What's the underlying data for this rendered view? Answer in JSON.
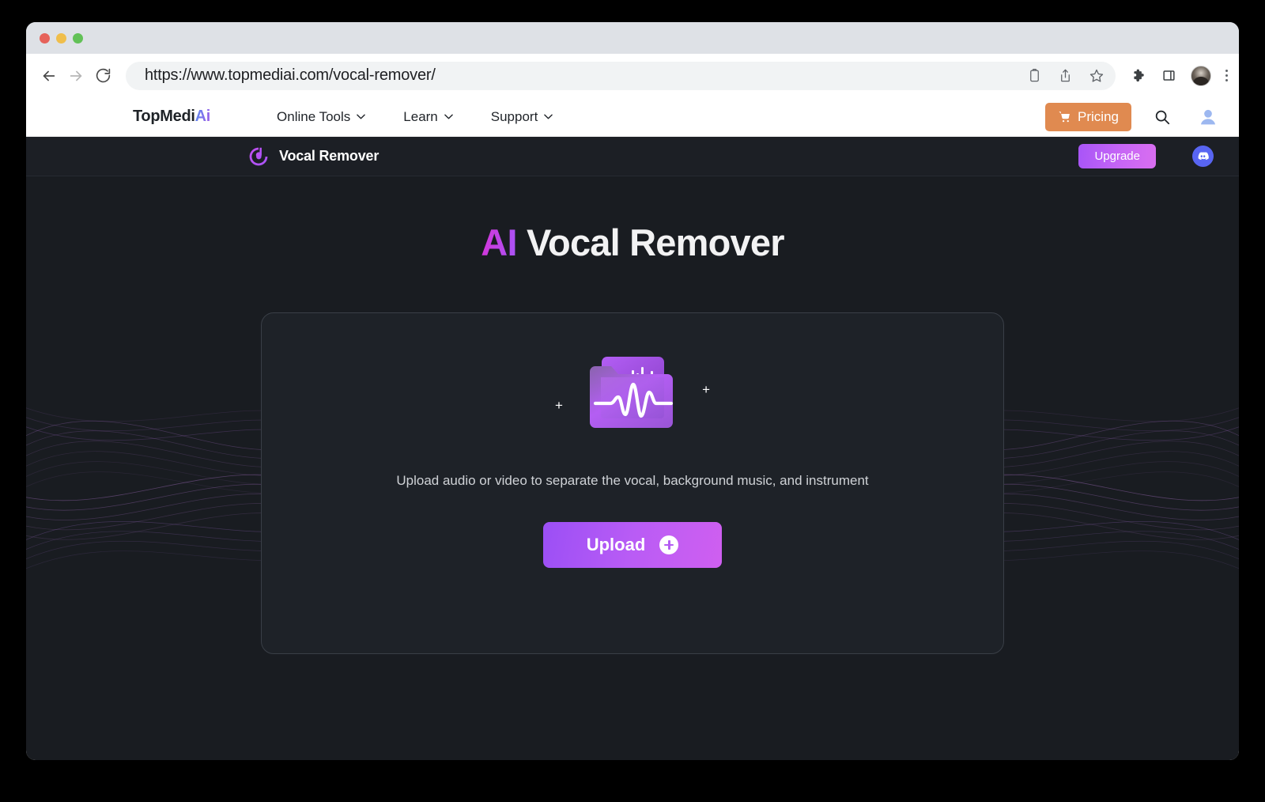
{
  "browser": {
    "url": "https://www.topmediai.com/vocal-remover/",
    "traffic_lights": [
      "close",
      "minimize",
      "maximize"
    ],
    "toolbar_icons": [
      "back-arrow",
      "forward-arrow",
      "reload",
      "clipboard-icon",
      "share-icon",
      "bookmark-star-icon",
      "extensions-puzzle-icon",
      "side-panel-icon",
      "profile-avatar",
      "menu-kebab-icon"
    ]
  },
  "site_nav": {
    "brand_main": "TopMedi",
    "brand_accent": "Ai",
    "links": [
      {
        "label": "Online Tools",
        "icon": "chevron-down-icon"
      },
      {
        "label": "Learn",
        "icon": "chevron-down-icon"
      },
      {
        "label": "Support",
        "icon": "chevron-down-icon"
      }
    ],
    "pricing_label": "Pricing",
    "pricing_icon": "shopping-cart-icon",
    "pricing_color": "#e08a50",
    "search_icon": "search-icon",
    "account_icon": "user-avatar-icon"
  },
  "app_header": {
    "logo_icon": "music-note-logo",
    "title": "Vocal Remover",
    "upgrade_label": "Upgrade",
    "upgrade_color": "#c766f5",
    "discord_icon": "discord-icon",
    "discord_color": "#5865f2"
  },
  "hero": {
    "title_accent": "AI",
    "title_main": "Vocal Remover",
    "accent_color": "#c434d8"
  },
  "dropzone": {
    "icon": "audio-folder-waveform-icon",
    "plus_left": "+",
    "plus_right": "+",
    "description": "Upload audio or video to separate the vocal, background music, and instrument",
    "upload_label": "Upload",
    "upload_icon": "plus-circle-icon",
    "upload_color": "#b95cf5"
  },
  "background": {
    "page_color": "#191c21",
    "card_color": "#1e2228",
    "decor": "purple-wave-ribbons"
  }
}
